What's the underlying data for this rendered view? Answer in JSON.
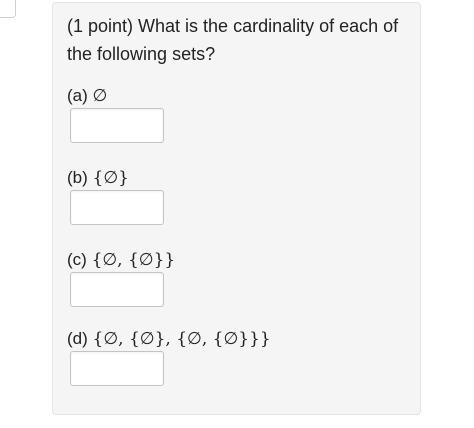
{
  "question": {
    "text": "(1 point) What is the cardinality of each of the following sets?"
  },
  "parts": [
    {
      "label": "(a)",
      "set": "∅",
      "answer": ""
    },
    {
      "label": "(b)",
      "set": "{∅}",
      "answer": ""
    },
    {
      "label": "(c)",
      "set": "{∅, {∅}}",
      "answer": ""
    },
    {
      "label": "(d)",
      "set": "{∅, {∅}, {∅, {∅}}}",
      "answer": ""
    }
  ],
  "icons": {
    "corner": "tab-corner"
  }
}
